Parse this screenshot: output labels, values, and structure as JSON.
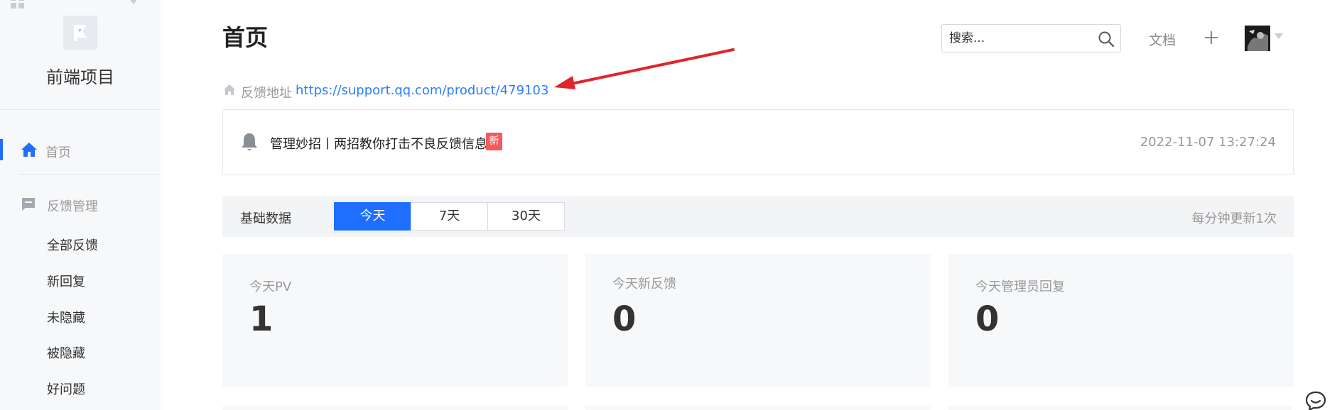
{
  "sidebar": {
    "project_name": "前端项目",
    "home_label": "首页",
    "group_label": "反馈管理",
    "sub_items": [
      "全部反馈",
      "新回复",
      "未隐藏",
      "被隐藏",
      "好问题"
    ]
  },
  "header": {
    "title": "首页",
    "search_placeholder": "搜索...",
    "docs_label": "文档"
  },
  "feedback": {
    "label": "反馈地址",
    "url": "https://support.qq.com/product/479103"
  },
  "notice": {
    "text": "管理妙招丨两招教你打击不良反馈信息",
    "badge": "新",
    "time": "2022-11-07 13:27:24"
  },
  "stats": {
    "label": "基础数据",
    "tabs": [
      "今天",
      "7天",
      "30天"
    ],
    "active_tab": "今天",
    "note": "每分钟更新1次"
  },
  "cards": [
    {
      "label": "今天PV",
      "value": "1"
    },
    {
      "label": "今天新反馈",
      "value": "0"
    },
    {
      "label": "今天管理员回复",
      "value": "0"
    }
  ],
  "colors": {
    "accent": "#1e6fff",
    "link": "#2c7ef8",
    "badge": "#f25b5b",
    "annotation_arrow": "#e0242b"
  },
  "icons": [
    "apps-icon",
    "chevron-down-icon",
    "flag-logo-icon",
    "home-icon",
    "message-icon",
    "search-icon",
    "plus-icon",
    "bell-icon",
    "chat-icon"
  ]
}
